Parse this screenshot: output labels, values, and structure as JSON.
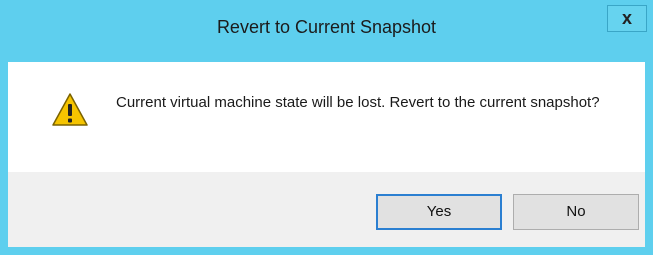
{
  "window": {
    "title": "Revert to Current Snapshot",
    "close_label": "x"
  },
  "message": {
    "text": "Current virtual machine state will be lost. Revert to the current snapshot?",
    "icon": "warning-icon"
  },
  "buttons": {
    "yes_label": "Yes",
    "no_label": "No"
  },
  "colors": {
    "titlebar": "#5ecfee",
    "footer": "#f0f0f0",
    "default_button_border": "#2b7fd1",
    "warning_fill": "#f5c400"
  }
}
